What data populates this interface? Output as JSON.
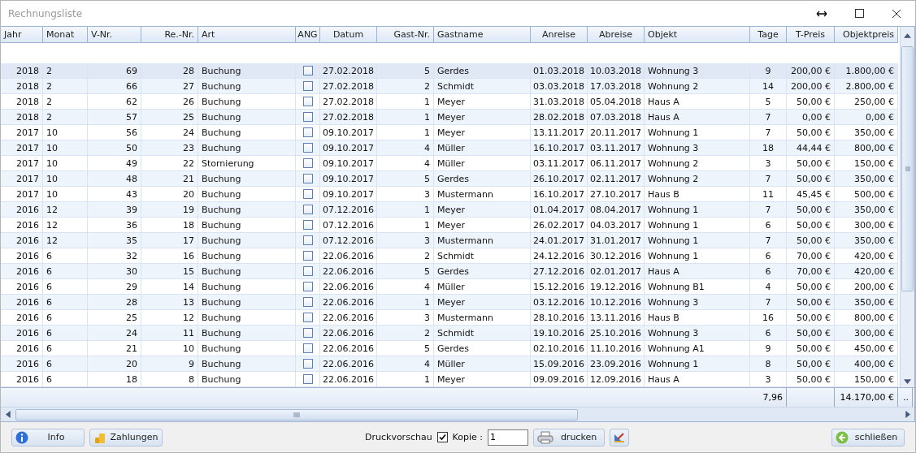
{
  "window": {
    "title": "Rechnungsliste"
  },
  "table": {
    "columns": [
      "Jahr",
      "Monat",
      "V-Nr.",
      "Re.-Nr.",
      "Art",
      "ANG",
      "Datum",
      "Gast-Nr.",
      "Gastname",
      "Anreise",
      "Abreise",
      "Objekt",
      "Tage",
      "T-Preis",
      "Objektpreis"
    ],
    "rows": [
      {
        "selected": true,
        "cells": [
          "2018",
          "2",
          "69",
          "28",
          "Buchung",
          {
            "checked": false
          },
          "27.02.2018",
          "5",
          "Gerdes",
          "01.03.2018",
          "10.03.2018",
          "Wohnung 3",
          "9",
          "200,00 €",
          "1.800,00 €"
        ]
      },
      {
        "selected": false,
        "cells": [
          "2018",
          "2",
          "66",
          "27",
          "Buchung",
          {
            "checked": false
          },
          "27.02.2018",
          "2",
          "Schmidt",
          "03.03.2018",
          "17.03.2018",
          "Wohnung 2",
          "14",
          "200,00 €",
          "2.800,00 €"
        ]
      },
      {
        "selected": false,
        "cells": [
          "2018",
          "2",
          "62",
          "26",
          "Buchung",
          {
            "checked": false
          },
          "27.02.2018",
          "1",
          "Meyer",
          "31.03.2018",
          "05.04.2018",
          "Haus A",
          "5",
          "50,00 €",
          "250,00 €"
        ]
      },
      {
        "selected": false,
        "cells": [
          "2018",
          "2",
          "57",
          "25",
          "Buchung",
          {
            "checked": false
          },
          "27.02.2018",
          "1",
          "Meyer",
          "28.02.2018",
          "07.03.2018",
          "Haus A",
          "7",
          "0,00 €",
          "0,00 €"
        ]
      },
      {
        "selected": false,
        "cells": [
          "2017",
          "10",
          "56",
          "24",
          "Buchung",
          {
            "checked": false
          },
          "09.10.2017",
          "1",
          "Meyer",
          "13.11.2017",
          "20.11.2017",
          "Wohnung 1",
          "7",
          "50,00 €",
          "350,00 €"
        ]
      },
      {
        "selected": false,
        "cells": [
          "2017",
          "10",
          "50",
          "23",
          "Buchung",
          {
            "checked": false
          },
          "09.10.2017",
          "4",
          "Müller",
          "16.10.2017",
          "03.11.2017",
          "Wohnung 3",
          "18",
          "44,44 €",
          "800,00 €"
        ]
      },
      {
        "selected": false,
        "cells": [
          "2017",
          "10",
          "49",
          "22",
          "Stornierung",
          {
            "checked": false
          },
          "09.10.2017",
          "4",
          "Müller",
          "03.11.2017",
          "06.11.2017",
          "Wohnung 2",
          "3",
          "50,00 €",
          "150,00 €"
        ]
      },
      {
        "selected": false,
        "cells": [
          "2017",
          "10",
          "48",
          "21",
          "Buchung",
          {
            "checked": false
          },
          "09.10.2017",
          "5",
          "Gerdes",
          "26.10.2017",
          "02.11.2017",
          "Wohnung 2",
          "7",
          "50,00 €",
          "350,00 €"
        ]
      },
      {
        "selected": false,
        "cells": [
          "2017",
          "10",
          "43",
          "20",
          "Buchung",
          {
            "checked": false
          },
          "09.10.2017",
          "3",
          "Mustermann",
          "16.10.2017",
          "27.10.2017",
          "Haus B",
          "11",
          "45,45 €",
          "500,00 €"
        ]
      },
      {
        "selected": false,
        "cells": [
          "2016",
          "12",
          "39",
          "19",
          "Buchung",
          {
            "checked": false
          },
          "07.12.2016",
          "1",
          "Meyer",
          "01.04.2017",
          "08.04.2017",
          "Wohnung 1",
          "7",
          "50,00 €",
          "350,00 €"
        ]
      },
      {
        "selected": false,
        "cells": [
          "2016",
          "12",
          "36",
          "18",
          "Buchung",
          {
            "checked": false
          },
          "07.12.2016",
          "1",
          "Meyer",
          "26.02.2017",
          "04.03.2017",
          "Wohnung 1",
          "6",
          "50,00 €",
          "300,00 €"
        ]
      },
      {
        "selected": false,
        "cells": [
          "2016",
          "12",
          "35",
          "17",
          "Buchung",
          {
            "checked": false
          },
          "07.12.2016",
          "3",
          "Mustermann",
          "24.01.2017",
          "31.01.2017",
          "Wohnung 1",
          "7",
          "50,00 €",
          "350,00 €"
        ]
      },
      {
        "selected": false,
        "cells": [
          "2016",
          "6",
          "32",
          "16",
          "Buchung",
          {
            "checked": false
          },
          "22.06.2016",
          "2",
          "Schmidt",
          "24.12.2016",
          "30.12.2016",
          "Wohnung 1",
          "6",
          "70,00 €",
          "420,00 €"
        ]
      },
      {
        "selected": false,
        "cells": [
          "2016",
          "6",
          "30",
          "15",
          "Buchung",
          {
            "checked": false
          },
          "22.06.2016",
          "5",
          "Gerdes",
          "27.12.2016",
          "02.01.2017",
          "Haus A",
          "6",
          "70,00 €",
          "420,00 €"
        ]
      },
      {
        "selected": false,
        "cells": [
          "2016",
          "6",
          "29",
          "14",
          "Buchung",
          {
            "checked": false
          },
          "22.06.2016",
          "4",
          "Müller",
          "15.12.2016",
          "19.12.2016",
          "Wohnung B1",
          "4",
          "50,00 €",
          "200,00 €"
        ]
      },
      {
        "selected": false,
        "cells": [
          "2016",
          "6",
          "28",
          "13",
          "Buchung",
          {
            "checked": false
          },
          "22.06.2016",
          "1",
          "Meyer",
          "03.12.2016",
          "10.12.2016",
          "Wohnung 3",
          "7",
          "50,00 €",
          "350,00 €"
        ]
      },
      {
        "selected": false,
        "cells": [
          "2016",
          "6",
          "25",
          "12",
          "Buchung",
          {
            "checked": false
          },
          "22.06.2016",
          "3",
          "Mustermann",
          "28.10.2016",
          "13.11.2016",
          "Haus B",
          "16",
          "50,00 €",
          "800,00 €"
        ]
      },
      {
        "selected": false,
        "cells": [
          "2016",
          "6",
          "24",
          "11",
          "Buchung",
          {
            "checked": false
          },
          "22.06.2016",
          "2",
          "Schmidt",
          "19.10.2016",
          "25.10.2016",
          "Wohnung 3",
          "6",
          "50,00 €",
          "300,00 €"
        ]
      },
      {
        "selected": false,
        "cells": [
          "2016",
          "6",
          "21",
          "10",
          "Buchung",
          {
            "checked": false
          },
          "22.06.2016",
          "5",
          "Gerdes",
          "02.10.2016",
          "11.10.2016",
          "Wohnung A1",
          "9",
          "50,00 €",
          "450,00 €"
        ]
      },
      {
        "selected": false,
        "cells": [
          "2016",
          "6",
          "20",
          "9",
          "Buchung",
          {
            "checked": false
          },
          "22.06.2016",
          "4",
          "Müller",
          "15.09.2016",
          "23.09.2016",
          "Wohnung 1",
          "8",
          "50,00 €",
          "400,00 €"
        ]
      },
      {
        "selected": false,
        "cells": [
          "2016",
          "6",
          "18",
          "8",
          "Buchung",
          {
            "checked": false
          },
          "22.06.2016",
          "1",
          "Meyer",
          "09.09.2016",
          "12.09.2016",
          "Haus A",
          "3",
          "50,00 €",
          "150,00 €"
        ]
      }
    ],
    "footer": {
      "tage": "7,96",
      "objektpreis": "14.170,00 €",
      "more": ".."
    }
  },
  "bottom_bar": {
    "info": "Info",
    "zahlungen": "Zahlungen",
    "druckvorschau": {
      "label": "Druckvorschau",
      "checked": true
    },
    "kopie": {
      "label": "Kopie :",
      "value": "1"
    },
    "drucken": "drucken",
    "schliessen": "schließen"
  }
}
